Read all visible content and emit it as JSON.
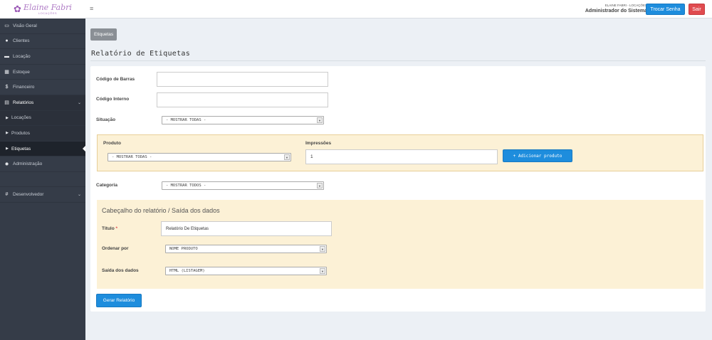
{
  "logo": {
    "brand": "Elaine Fabri",
    "subtitle": "LOCAÇÕES",
    "icon": "flower-icon"
  },
  "sidebar": {
    "items": [
      {
        "label": "Visão Geral",
        "icon": "monitor-icon"
      },
      {
        "label": "Clientes",
        "icon": "users-icon"
      },
      {
        "label": "Locação",
        "icon": "car-icon"
      },
      {
        "label": "Estoque",
        "icon": "grid-icon"
      },
      {
        "label": "Financeiro",
        "icon": "dollar-icon"
      },
      {
        "label": "Relatórios",
        "icon": "print-icon"
      },
      {
        "label": "Locações",
        "icon": "caret-right-icon"
      },
      {
        "label": "Produtos",
        "icon": "caret-right-icon"
      },
      {
        "label": "Etiquetas",
        "icon": "caret-right-icon"
      },
      {
        "label": "Administração",
        "icon": "gear-icon"
      },
      {
        "label": "Desenvolvedor",
        "icon": "hash-icon"
      }
    ]
  },
  "topbar": {
    "company": "ELAINE FABRI - LOCAÇÕES",
    "user": "Administrador do Sistema",
    "change_password": "Trocar Senha",
    "logout": "Sair"
  },
  "breadcrumb": "Etiquetas",
  "page_title": "Relatório de Etiquetas",
  "form": {
    "barcode_label": "Código de Barras",
    "barcode_value": "",
    "internal_code_label": "Código Interno",
    "internal_code_value": "",
    "status_label": "Situação",
    "status_value": "- MOSTRAR TODAS -",
    "product_label": "Produto",
    "product_value": "- MOSTRAR TODAS -",
    "prints_label": "Impressões",
    "prints_value": "1",
    "add_product": "+ Adicionar produto",
    "category_label": "Categoria",
    "category_value": "- MOSTRAR TODOS -",
    "output_header": "Cabeçalho do relatório / Saída dos dados",
    "title_label": "Título",
    "required_mark": "*",
    "title_value": "Relatório De Etiquetas",
    "order_label": "Ordenar por",
    "order_value": "NOME PRODUTO",
    "output_label": "Saída dos dados",
    "output_value": "HTML (LISTAGEM)",
    "generate": "Gerar Relatório"
  },
  "colors": {
    "sidebar": "#353c48",
    "accent": "#1e8ddd",
    "danger": "#e04b4f",
    "panel": "#fcf1d6"
  }
}
